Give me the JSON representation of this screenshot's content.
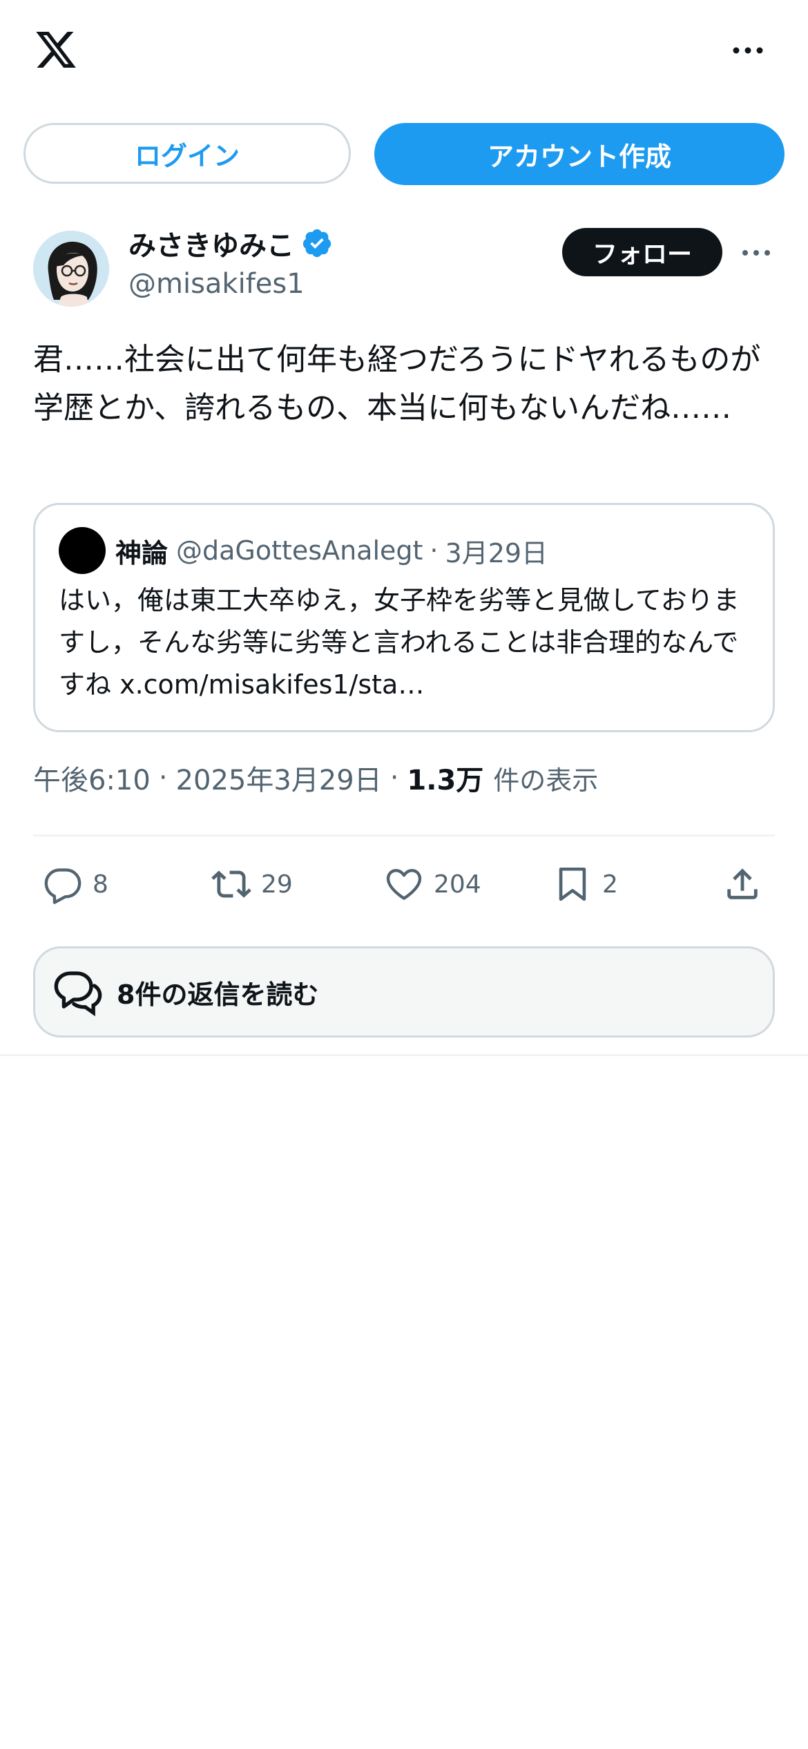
{
  "header": {
    "logo_icon": "x-logo-icon",
    "more_icon": "more-horizontal-icon"
  },
  "auth": {
    "login_label": "ログイン",
    "signup_label": "アカウント作成"
  },
  "author": {
    "display_name": "みさきゆみこ",
    "handle": "@misakifes1",
    "verified": true,
    "follow_label": "フォロー"
  },
  "tweet": {
    "text": "君……社会に出て何年も経つだろうにドヤれるものが学歴とか、誇れるもの、本当に何もないんだね……"
  },
  "quote": {
    "name": "神論",
    "handle": "@daGottesAnalegt",
    "separator": "·",
    "date": "3月29日",
    "text": "はい，俺は東工大卒ゆえ，女子枠を劣等と見做しておりますし，そんな劣等に劣等と言われることは非合理的なんですね x.com/misakifes1/sta…"
  },
  "meta": {
    "time": "午後6:10",
    "separator": "·",
    "date": "2025年3月29日",
    "views_count": "1.3万",
    "views_label": "件の表示"
  },
  "actions": {
    "replies": "8",
    "retweets": "29",
    "likes": "204",
    "bookmarks": "2"
  },
  "replies_link": {
    "label": "8件の返信を読む"
  },
  "colors": {
    "accent": "#1d9bf0",
    "text_primary": "#0f1419",
    "text_secondary": "#536471",
    "border": "#cfd9de"
  }
}
